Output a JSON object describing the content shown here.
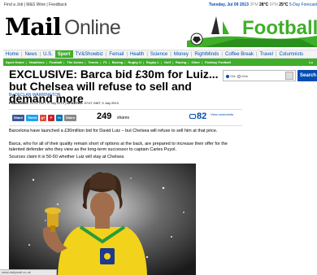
{
  "topbar": {
    "links": "Find a Job | M&S Wine | Feedback",
    "date": "Tuesday, Jul 09 2013",
    "time": "3PM",
    "temp_high": "28°C",
    "time2": "6PM",
    "temp_low": "25°C",
    "forecast": "5-Day Forecast"
  },
  "masthead": {
    "logo_mail": "Mail",
    "logo_online": "Online",
    "section": "Football"
  },
  "nav": {
    "items": [
      "Home",
      "News",
      "U.S.",
      "Sport",
      "TV&Showbiz",
      "Femail",
      "Health",
      "Science",
      "Money",
      "RightMinds",
      "Coffee Break",
      "Travel",
      "Columnists"
    ],
    "active": "Sport"
  },
  "subnav": {
    "items": [
      "Sport Home",
      "Headlines",
      "Football",
      "The Ashes",
      "Tennis",
      "F1",
      "Boxing",
      "Rugby U",
      "Rugby L",
      "Golf",
      "Racing",
      "Other",
      "Fantasy Football"
    ],
    "right": "Lo"
  },
  "search": {
    "option_site": "Site",
    "option_web": "Web",
    "button": "Search"
  },
  "article": {
    "headline": "EXCLUSIVE: Barca bid £30m for Luiz... but Chelsea will refuse to sell and demand more",
    "byline": "By DECLAN WARRINGTON",
    "published_label": "PUBLISHED:",
    "published": "22:24 GMT, 8 July 2013",
    "updated_label": "UPDATED:",
    "updated": "07:07 GMT, 9 July 2013",
    "paragraphs": [
      "Barcelona have launched a £30million bid for David Luiz – but Chelsea will refuse to sell him at that price.",
      "Barca, who for all of their quality remain short of options at the back, are prepared to increase their offer for the talented defender who they view as the long-term successor to captain Carles Puyol.",
      "Sources claim it is 50-50 whether Luiz will stay at Chelsea"
    ]
  },
  "share": {
    "facebook": "Share",
    "twitter": "Tweet",
    "google": "g+",
    "pinterest": "P",
    "linkedin": "in",
    "email": "Share",
    "count": "249",
    "count_label": "shares",
    "comments": "82",
    "comments_label": "View comments"
  },
  "status": {
    "url": "www.dailymail.co.uk"
  },
  "colors": {
    "accent_green": "#3fae2a",
    "link_blue": "#004db3"
  }
}
